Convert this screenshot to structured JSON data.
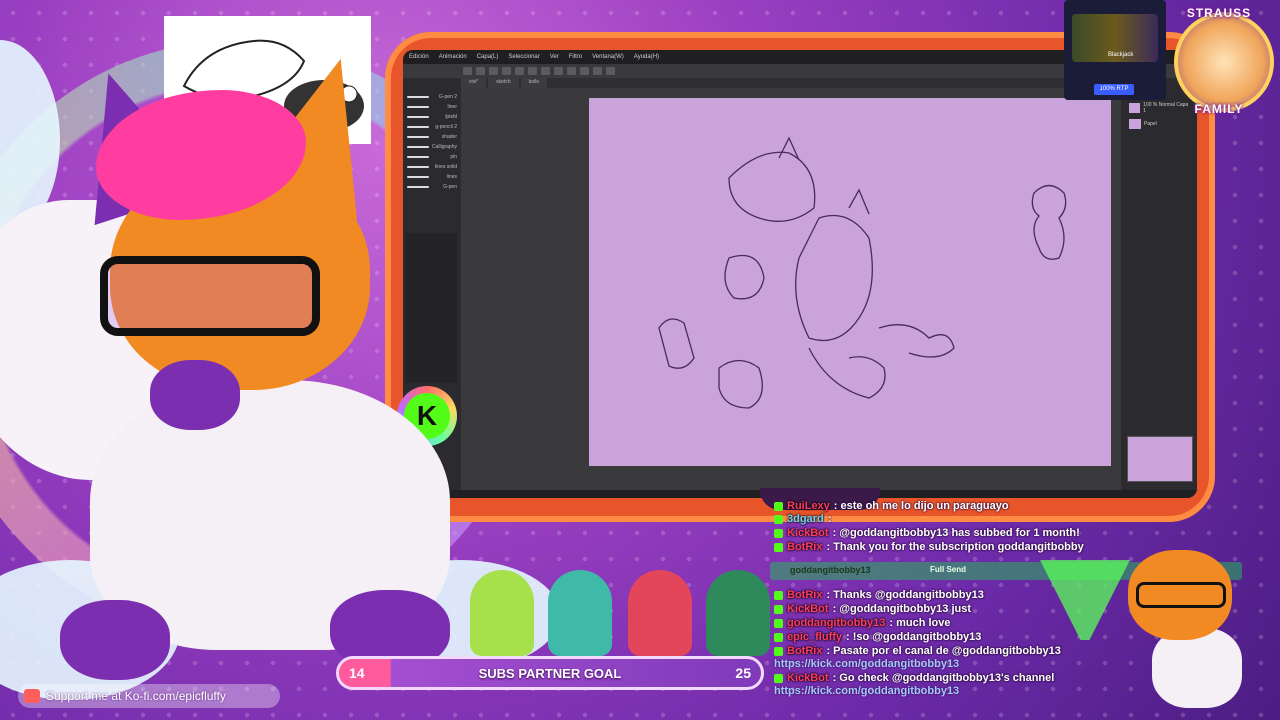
{
  "app": {
    "menu": [
      "Edición",
      "Animación",
      "Capa(L)",
      "Seleccionar",
      "Ver",
      "Filtro",
      "Ventana(W)",
      "Ayuda(H)"
    ],
    "tabs": [
      "vivi*",
      "sketch",
      "boile"
    ],
    "brushes": [
      "G-pen 2",
      "liner",
      "lpiebl",
      "g-pencil 2",
      "shader",
      "Calligraphy",
      "pin",
      "lines solid",
      "lines",
      "G-pen"
    ],
    "layers": [
      "100 % Normal Capa 1",
      "Papel"
    ]
  },
  "ad": {
    "title": "Blackjack",
    "button": "100% RTP"
  },
  "badge": {
    "top": "STRAUSS",
    "bottom": "FAMILY"
  },
  "kick_logo": "K",
  "chat": {
    "lines": [
      {
        "user": "RuiLexy",
        "text": ": este oh me lo dijo un paraguayo"
      },
      {
        "user": "3dgard",
        "text": ":"
      },
      {
        "user": "KickBot",
        "text": ": @goddangitbobby13 has subbed for 1 month!"
      },
      {
        "user": "BotRix",
        "text": ": Thank you for the subscription goddangitbobby"
      },
      {
        "user": "BotRix",
        "text": ": Thanks @goddangitbobby13"
      },
      {
        "user": "KickBot",
        "text": ": @goddangitbobby13 just"
      },
      {
        "user": "goddangitbobby13",
        "text": ": much love"
      },
      {
        "user": "epic_fluffy",
        "text": ": !so @goddangitbobby13"
      },
      {
        "user": "BotRix",
        "text": ": Pasate por el canal de @goddangitbobby13"
      },
      {
        "user": "",
        "text": "https://kick.com/goddangitbobby13"
      },
      {
        "user": "KickBot",
        "text": ": Go check @goddangitbobby13's channel"
      },
      {
        "user": "",
        "text": "https://kick.com/goddangitbobby13"
      }
    ],
    "send_user": "goddangitbobby13",
    "send_label": "Full Send"
  },
  "goal": {
    "current": "14",
    "label": "SUBS PARTNER GOAL",
    "target": "25",
    "progress": 0.56
  },
  "kofi": {
    "text": "Support me at Ko-fi.com/epicfluffy"
  },
  "colors": {
    "accent_orange": "#e9552a",
    "kick_green": "#53fc18",
    "goal_pink": "#ff5a9b",
    "canvas_lilac": "#c9a3d9"
  }
}
